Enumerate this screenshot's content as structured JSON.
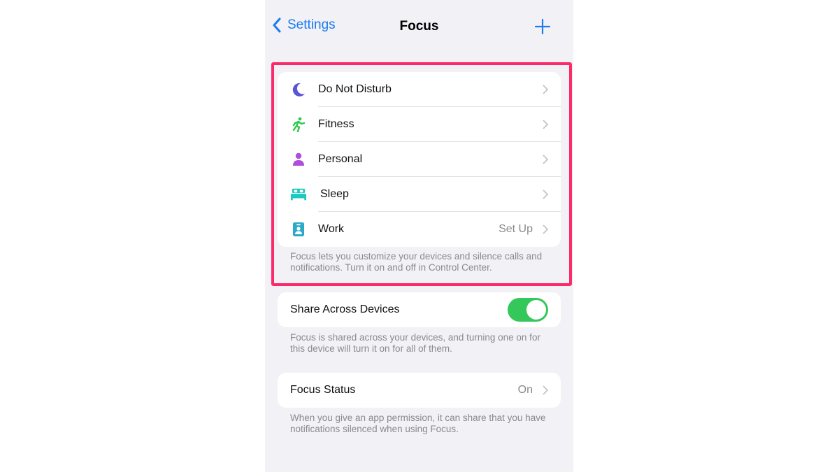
{
  "nav": {
    "back_label": "Settings",
    "title": "Focus",
    "add_icon": "plus-icon"
  },
  "focus_modes": {
    "items": [
      {
        "label": "Do Not Disturb",
        "icon": "moon-icon",
        "color": "#5a54d6",
        "value": ""
      },
      {
        "label": "Fitness",
        "icon": "running-figure-icon",
        "color": "#2ec84a",
        "value": ""
      },
      {
        "label": "Personal",
        "icon": "person-icon",
        "color": "#ae4fd9",
        "value": ""
      },
      {
        "label": "Sleep",
        "icon": "bed-icon",
        "color": "#1ec8c0",
        "value": ""
      },
      {
        "label": "Work",
        "icon": "id-badge-icon",
        "color": "#2aa9c9",
        "value": "Set Up"
      }
    ],
    "footer": "Focus lets you customize your devices and silence calls and notifications. Turn it on and off in Control Center."
  },
  "share": {
    "label": "Share Across Devices",
    "enabled": true,
    "footer": "Focus is shared across your devices, and turning one on for this device will turn it on for all of them."
  },
  "status": {
    "label": "Focus Status",
    "value": "On",
    "footer": "When you give an app permission, it can share that you have notifications silenced when using Focus."
  },
  "colors": {
    "accent": "#1a7bf2",
    "highlight": "#fd2a6a",
    "toggle_on": "#34c759"
  }
}
